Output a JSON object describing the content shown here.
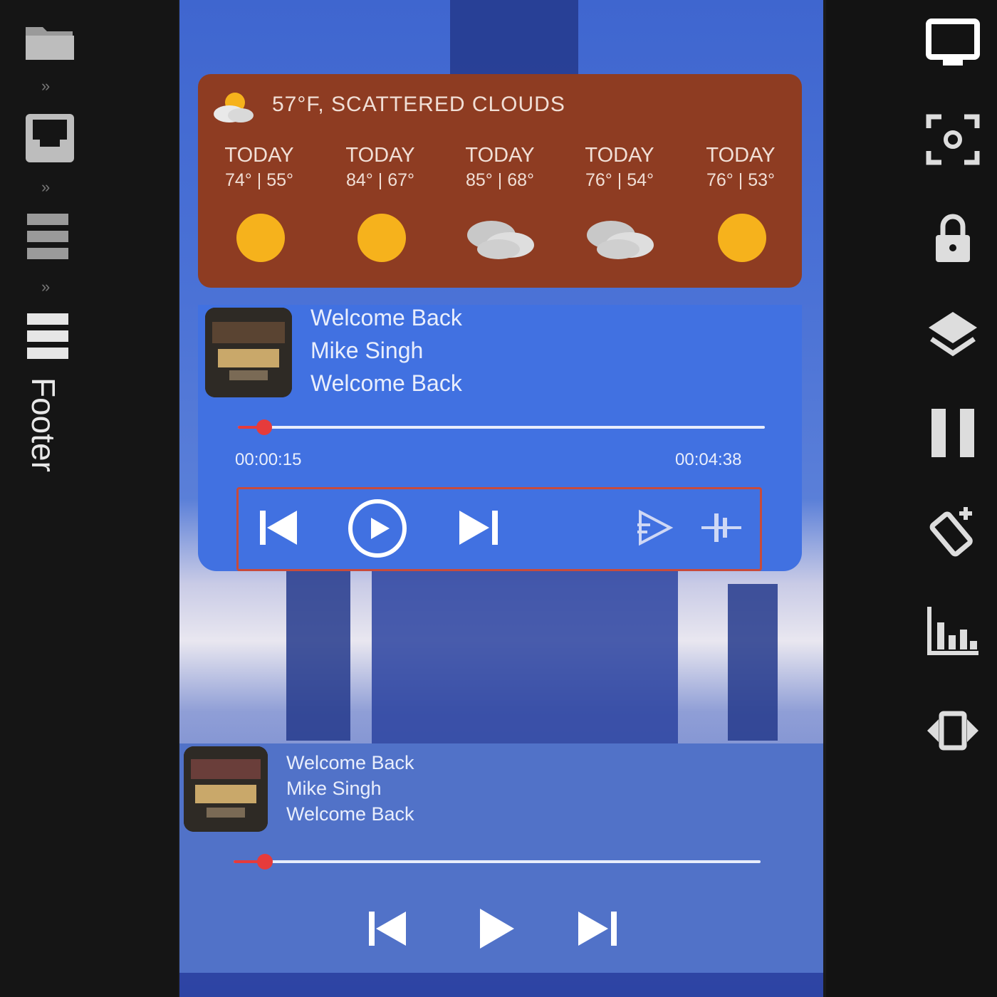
{
  "editor": {
    "footer_label": "Footer",
    "left_icons": [
      "folder-icon",
      "header-frame-icon",
      "body-rows-icon",
      "footer-rows-icon"
    ],
    "right_icons": [
      "monitor-icon",
      "screenshot-icon",
      "lock-icon",
      "layers-icon",
      "pause-icon",
      "rotate-icon",
      "equalizer-icon",
      "resize-icon"
    ]
  },
  "weather": {
    "current": "57°F, SCATTERED CLOUDS",
    "current_icon": "partly-cloudy-icon",
    "days": [
      {
        "name": "TODAY",
        "temp": "74° | 55°",
        "icon": "sun-icon"
      },
      {
        "name": "TODAY",
        "temp": "84° | 67°",
        "icon": "sun-icon"
      },
      {
        "name": "TODAY",
        "temp": "85° | 68°",
        "icon": "clouds-icon"
      },
      {
        "name": "TODAY",
        "temp": "76° | 54°",
        "icon": "clouds-icon"
      },
      {
        "name": "TODAY",
        "temp": "76° | 53°",
        "icon": "sun-icon"
      }
    ],
    "bg_color": "#8e3c22",
    "sun_color": "#f6b21c"
  },
  "player1": {
    "title": "Welcome Back",
    "artist": "Mike Singh",
    "album": "Welcome Back",
    "elapsed": "00:00:15",
    "duration": "00:04:38",
    "progress": 0.05,
    "accent": "#e63b3b",
    "bg_color": "#4171e1"
  },
  "player2": {
    "title": "Welcome Back",
    "artist": "Mike Singh",
    "album": "Welcome Back",
    "progress": 0.06,
    "bg_color": "#5172c8"
  }
}
